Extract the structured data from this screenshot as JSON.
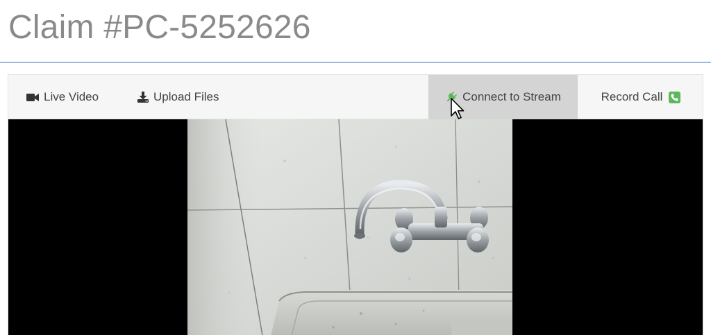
{
  "page": {
    "title": "Claim #PC-5252626"
  },
  "toolbar": {
    "live_video": {
      "label": "Live Video",
      "icon": "video-camera-icon"
    },
    "upload_files": {
      "label": "Upload Files",
      "icon": "download-icon"
    },
    "connect_stream": {
      "label": "Connect to Stream",
      "icon": "plug-icon",
      "icon_color": "#5cb85c"
    },
    "record_call": {
      "label": "Record Call",
      "icon": "phone-square-icon",
      "icon_color": "#5cb85c"
    }
  },
  "video": {
    "subject": "faucet-over-sink"
  },
  "colors": {
    "title": "#8a8a8a",
    "divider": "#9bb9d9",
    "toolbar_bg": "#f6f6f6",
    "active_bg": "#d4d4d4",
    "accent_green": "#5cb85c"
  }
}
